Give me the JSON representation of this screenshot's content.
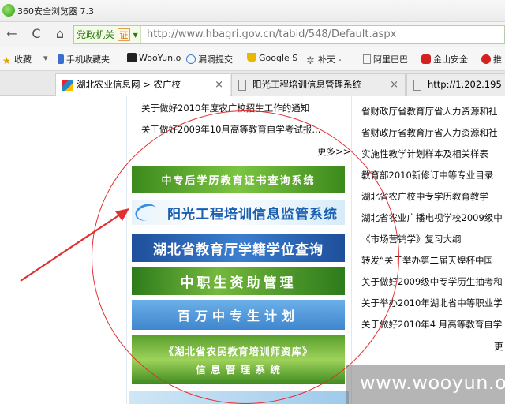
{
  "window": {
    "title": "360安全浏览器 7.3"
  },
  "navbar": {
    "back": "←",
    "refresh": "C",
    "home": "⌂",
    "cert_label": "党政机关",
    "cert_badge": "证",
    "cert_drop": "▾",
    "url": "http://www.hbagri.gov.cn/tabid/548/Default.aspx"
  },
  "bookmarks": [
    {
      "label": "收藏",
      "icon": "star-icon"
    },
    {
      "label": "▾",
      "icon": ""
    },
    {
      "label": "手机收藏夹",
      "icon": "phone-icon"
    },
    {
      "label": "WooYun.o",
      "icon": "wooyun-icon"
    },
    {
      "label": "漏洞提交",
      "icon": "globe-icon"
    },
    {
      "label": "Google S",
      "icon": "trophy-icon"
    },
    {
      "label": "补天 -",
      "icon": "gear-icon"
    },
    {
      "label": "阿里巴巴",
      "icon": "page-icon"
    },
    {
      "label": "金山安全",
      "icon": "kingsoft-icon"
    },
    {
      "label": "推",
      "icon": "tui-icon"
    }
  ],
  "tabs": [
    {
      "label": "湖北农业信息网 > 农广校",
      "close": "×"
    },
    {
      "label": "阳光工程培训信息管理系统",
      "close": "×"
    },
    {
      "label": "http://1.202.195",
      "close": ""
    }
  ],
  "left_news": [
    "关于做好2010年度农广校招生工作的通知",
    "关于做好2009年10月高等教育自学考试报..."
  ],
  "left_more": "更多>>",
  "banners": {
    "b1": "中专后学历教育证书查询系统",
    "b2": "阳光工程培训信息监管系统",
    "b3": "湖北省教育厅学籍学位查询",
    "b4": "中职生资助管理",
    "b5": "百万中专生计划",
    "b6_line1": "《湖北省农民教育培训师资库》",
    "b6_line2": "信 息 管 理 系 统"
  },
  "right_links": [
    "省财政厅省教育厅省人力资源和社",
    "省财政厅省教育厅省人力资源和社",
    "实施性教学计划样本及相关样表",
    "教育部2010新修订中等专业目录",
    "湖北省农广校中专学历教育教学",
    "湖北省农业广播电视学校2009级中",
    "《市场营销学》复习大纲",
    "转发“关于举办第二届天煌杯中国",
    "关于做好2009级中专学历生抽考和",
    "关于举办2010年湖北省中等职业学",
    "关于做好2010年4 月高等教育自学"
  ],
  "right_more": "更",
  "watermark": "www.wooyun.org",
  "colors": {
    "annotation_red": "#e03030",
    "accent_green": "#2d7a10"
  }
}
